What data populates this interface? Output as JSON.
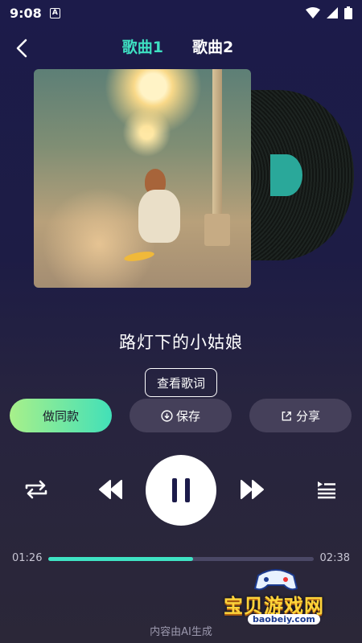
{
  "status_bar": {
    "time": "9:08",
    "notification_letter": "A"
  },
  "header": {
    "tabs": [
      {
        "label": "歌曲1",
        "active": true
      },
      {
        "label": "歌曲2",
        "active": false
      }
    ]
  },
  "song": {
    "title": "路灯下的小姑娘"
  },
  "buttons": {
    "lyrics": "查看歌词",
    "make_same": "做同款",
    "save": "保存",
    "share": "分享"
  },
  "player": {
    "current_time": "01:26",
    "duration": "02:38",
    "progress": 0.544,
    "state": "playing"
  },
  "footer": {
    "note": "内容由AI生成"
  },
  "watermark": {
    "text": "宝贝游戏网",
    "url": "baobeiy.com"
  },
  "colors": {
    "accent": "#3ee0c2",
    "background": "#1c1b4a",
    "button_bg": "#45405a"
  }
}
